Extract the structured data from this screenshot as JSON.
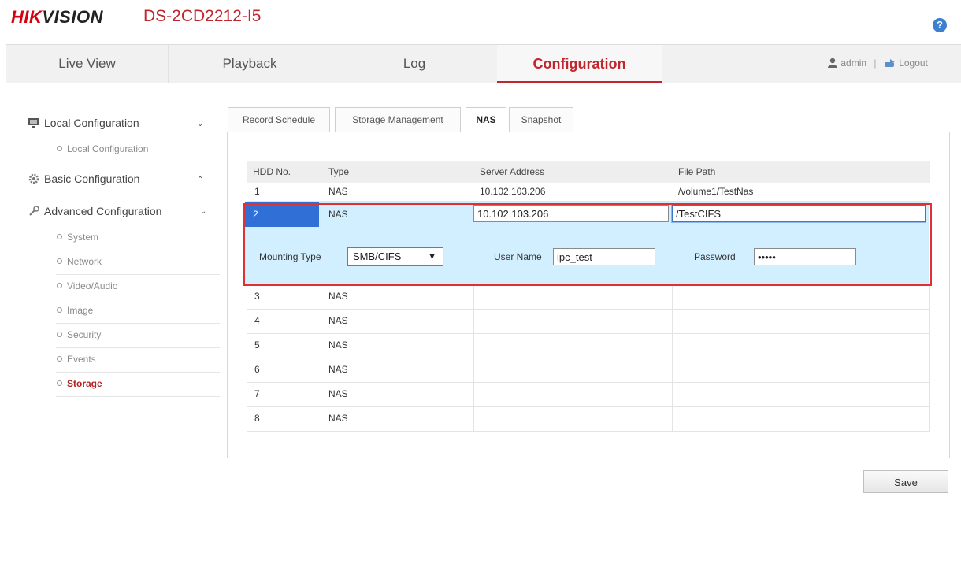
{
  "header": {
    "brand_hik": "HIK",
    "brand_vision": "VISION",
    "model": "DS-2CD2212-I5",
    "help_icon": "question-circle-icon"
  },
  "nav": {
    "tabs": [
      {
        "label": "Live View"
      },
      {
        "label": "Playback"
      },
      {
        "label": "Log"
      },
      {
        "label": "Configuration",
        "active": true
      }
    ],
    "user": "admin",
    "separator": "|",
    "logout": "Logout"
  },
  "sidebar": {
    "local": {
      "label": "Local Configuration",
      "icon": "monitor-icon",
      "expanded": true
    },
    "local_items": [
      {
        "label": "Local Configuration"
      }
    ],
    "basic": {
      "label": "Basic Configuration",
      "icon": "gear-icon",
      "expanded": false
    },
    "advanced": {
      "label": "Advanced Configuration",
      "icon": "wrench-icon",
      "expanded": true
    },
    "advanced_items": [
      {
        "label": "System"
      },
      {
        "label": "Network"
      },
      {
        "label": "Video/Audio"
      },
      {
        "label": "Image"
      },
      {
        "label": "Security"
      },
      {
        "label": "Events"
      },
      {
        "label": "Storage",
        "active": true
      }
    ]
  },
  "subtabs": [
    {
      "label": "Record Schedule"
    },
    {
      "label": "Storage Management"
    },
    {
      "label": "NAS",
      "active": true
    },
    {
      "label": "Snapshot"
    }
  ],
  "table": {
    "columns": [
      "HDD No.",
      "Type",
      "Server Address",
      "File Path"
    ],
    "rows": [
      {
        "no": "1",
        "type": "NAS",
        "server": "10.102.103.206",
        "path": "/volume1/TestNas"
      },
      {
        "no": "2",
        "type": "NAS",
        "server": "10.102.103.206",
        "path": "/TestCIFS",
        "selected": true
      },
      {
        "no": "3",
        "type": "NAS",
        "server": "",
        "path": ""
      },
      {
        "no": "4",
        "type": "NAS",
        "server": "",
        "path": ""
      },
      {
        "no": "5",
        "type": "NAS",
        "server": "",
        "path": ""
      },
      {
        "no": "6",
        "type": "NAS",
        "server": "",
        "path": ""
      },
      {
        "no": "7",
        "type": "NAS",
        "server": "",
        "path": ""
      },
      {
        "no": "8",
        "type": "NAS",
        "server": "",
        "path": ""
      }
    ]
  },
  "edit": {
    "mounting_label": "Mounting Type",
    "mounting_value": "SMB/CIFS",
    "username_label": "User Name",
    "username_value": "ipc_test",
    "password_label": "Password",
    "password_value": "•••••"
  },
  "save_label": "Save",
  "colors": {
    "accent": "#c0262d",
    "selected_row": "#d2efff",
    "selected_cell": "#2f6fd6",
    "highlight_box": "#e03030"
  }
}
